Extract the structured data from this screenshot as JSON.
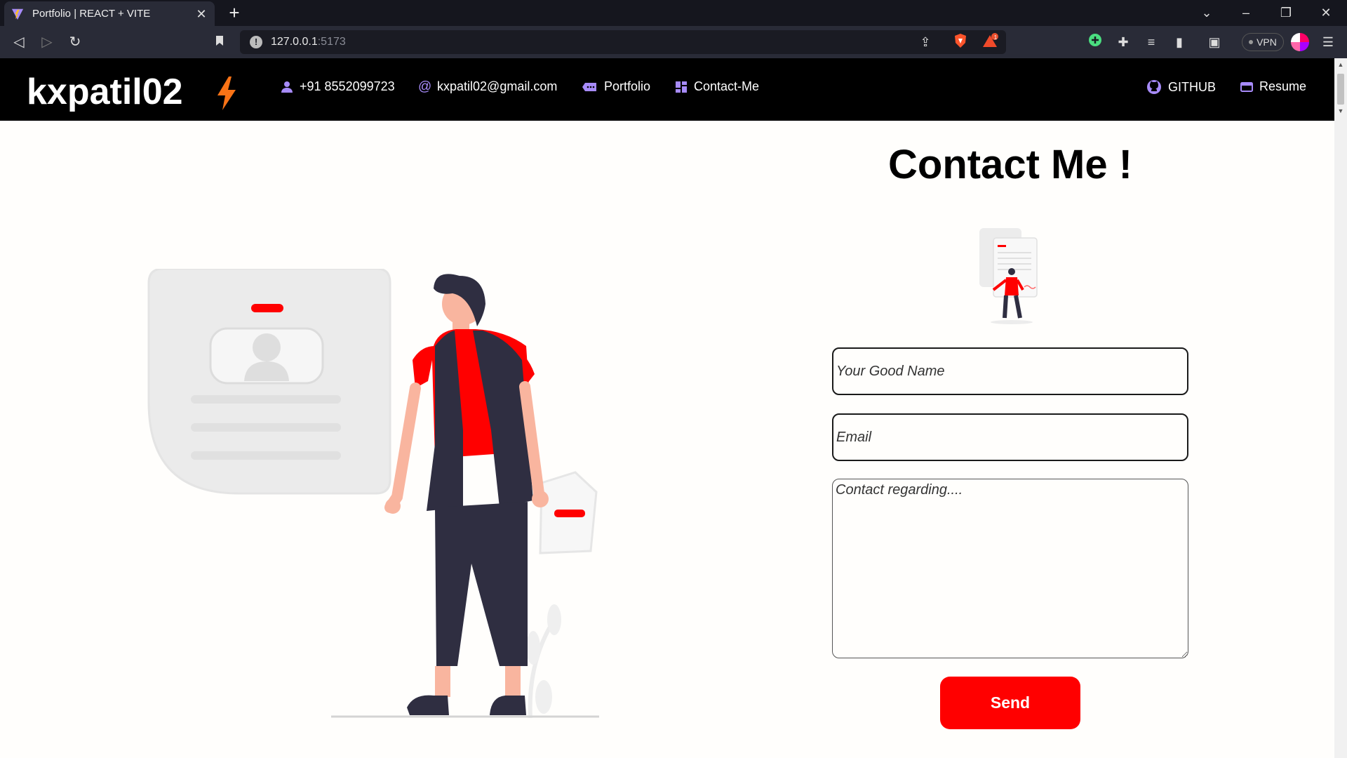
{
  "browser": {
    "tab_title": "Portfolio | REACT + VITE",
    "url_host": "127.0.0.1",
    "url_port": ":5173",
    "vpn_label": "VPN",
    "notification_count": "1"
  },
  "site": {
    "brand": "kxpatil02",
    "nav": {
      "phone": "+91 8552099723",
      "email": "kxpatil02@gmail.com",
      "portfolio": "Portfolio",
      "contact": "Contact-Me",
      "github": "GITHUB",
      "resume": "Resume"
    },
    "accent_color": "#ff0000",
    "nav_icon_color": "#a78bfa",
    "bolt_color": "#f97316"
  },
  "contact": {
    "title": "Contact Me !",
    "name_placeholder": "Your Good Name",
    "email_placeholder": "Email",
    "message_placeholder": "Contact regarding....",
    "send_label": "Send"
  }
}
